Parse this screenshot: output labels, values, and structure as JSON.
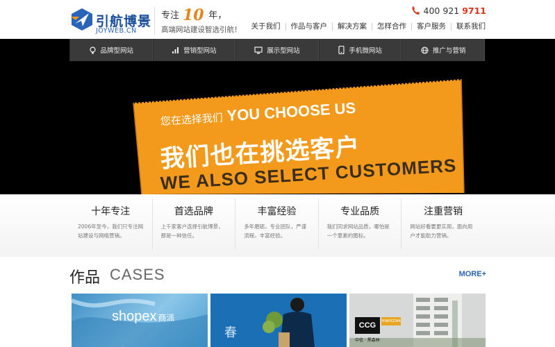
{
  "header": {
    "logo_cn": "引航博景",
    "logo_en": "JOYWEB.CN",
    "slogan_prefix": "专注",
    "slogan_num": "10",
    "slogan_suffix": "年，",
    "slogan_sub": "高端网站建设智选引航！",
    "phone_prefix": "400 921 ",
    "phone_highlight": "9711",
    "nav": [
      "关于我们",
      "作品与客户",
      "解决方案",
      "怎样合作",
      "客户服务",
      "联系我们"
    ]
  },
  "categories": [
    {
      "label": "品牌型网站",
      "icon": "bulb-icon"
    },
    {
      "label": "营销型网站",
      "icon": "bar-chart-icon"
    },
    {
      "label": "展示型网站",
      "icon": "monitor-icon"
    },
    {
      "label": "手机微网站",
      "icon": "mobile-icon"
    },
    {
      "label": "推广与营销",
      "icon": "globe-icon"
    }
  ],
  "banner": {
    "line1_cn": "您在选择我们",
    "line1_en": "YOU CHOOSE US",
    "line2": "我们也在挑选客户",
    "line3": "WE ALSO SELECT CUSTOMERS",
    "board_color": "#f39a1c"
  },
  "features": [
    {
      "title": "十年专注",
      "desc": "2006年至今，我们只专注网站建设与网络营销。"
    },
    {
      "title": "首选品牌",
      "desc": "上千家客户选择引航博景，那是一种信任。"
    },
    {
      "title": "丰富经验",
      "desc": "多年磨砺，专业团队，严谨流程，丰富经验。"
    },
    {
      "title": "专业品质",
      "desc": "我们同求网站品质，哪怕是一个意素的图标。"
    },
    {
      "title": "注重营销",
      "desc": "网站好看要更实用，面向用户才能助力营销。"
    }
  ],
  "cases": {
    "title_cn": "作品",
    "title_en": "CASES",
    "more": "MORE+",
    "thumbs": [
      {
        "brand": "shopex",
        "brand_cn": "商派"
      },
      {
        "text": "春"
      },
      {
        "badge": "CCG",
        "tag": "SCHWARZWALD",
        "sub": "中信 · 黑森林"
      }
    ]
  },
  "colors": {
    "accent": "#f39a1c",
    "brand_blue": "#2a64b8",
    "phone_red": "#e0321a",
    "catbar": "#3a3a3a"
  }
}
